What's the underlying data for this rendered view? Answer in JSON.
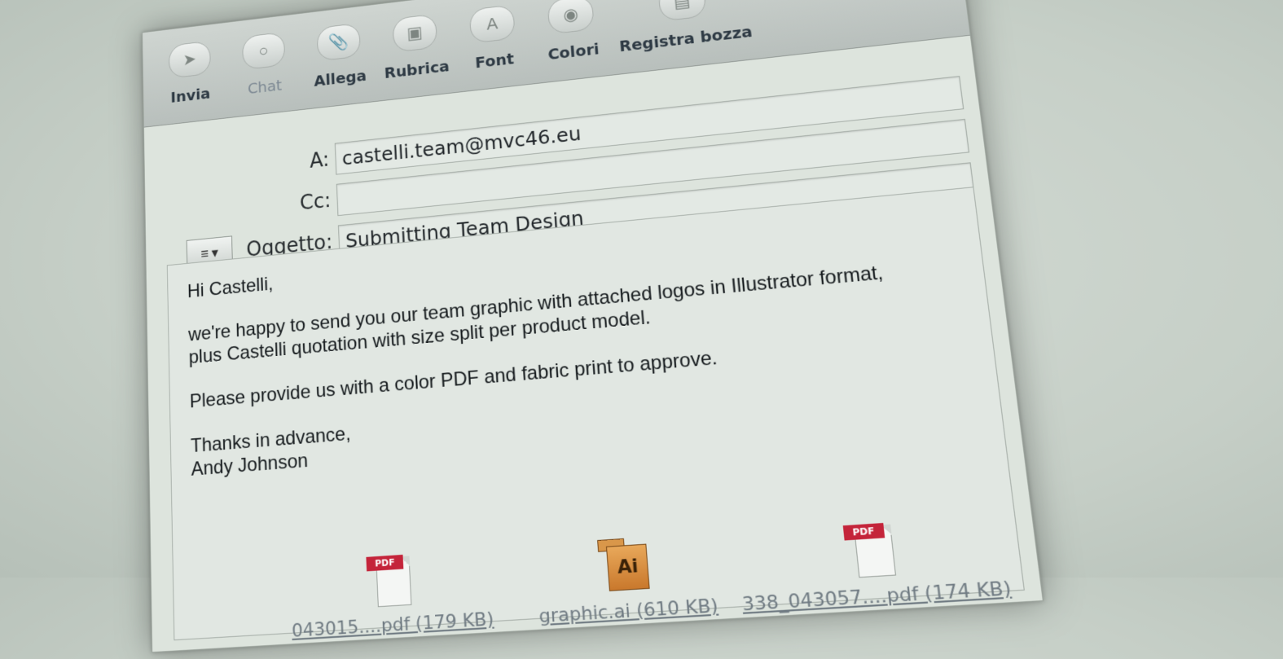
{
  "toolbar": {
    "items": [
      {
        "label": "Invia",
        "icon": "send-icon",
        "dim": false
      },
      {
        "label": "Chat",
        "icon": "chat-icon",
        "dim": true
      },
      {
        "label": "Allega",
        "icon": "paperclip-icon",
        "dim": false
      },
      {
        "label": "Rubrica",
        "icon": "address-book-icon",
        "dim": false
      },
      {
        "label": "Font",
        "icon": "font-icon",
        "dim": false
      },
      {
        "label": "Colori",
        "icon": "color-wheel-icon",
        "dim": false
      },
      {
        "label": "Registra bozza",
        "icon": "save-draft-icon",
        "dim": false
      }
    ]
  },
  "header": {
    "to_label": "A:",
    "to_value": "castelli.team@mvc46.eu",
    "cc_label": "Cc:",
    "cc_value": "",
    "subject_label": "Oggetto:",
    "subject_value": "Submitting Team Design"
  },
  "message": {
    "greeting": "Hi Castelli,",
    "paragraph1_line1": "we're happy to send you our team graphic with attached logos in Illustrator format,",
    "paragraph1_line2": "plus Castelli quotation with size split per product model.",
    "paragraph2": "Please provide us with a color PDF and fabric print to approve.",
    "closing": "Thanks in advance,",
    "signature": "Andy Johnson"
  },
  "attachments": [
    {
      "name": "043015....pdf (179 KB)",
      "type": "pdf"
    },
    {
      "name": "graphic.ai (610 KB)",
      "type": "ai"
    },
    {
      "name": "338_043057....pdf (174 KB)",
      "type": "pdf"
    }
  ],
  "colors": {
    "pdf_badge": "#c4243a",
    "ai_icon": "#c9782c",
    "link": "#6f7a82"
  }
}
